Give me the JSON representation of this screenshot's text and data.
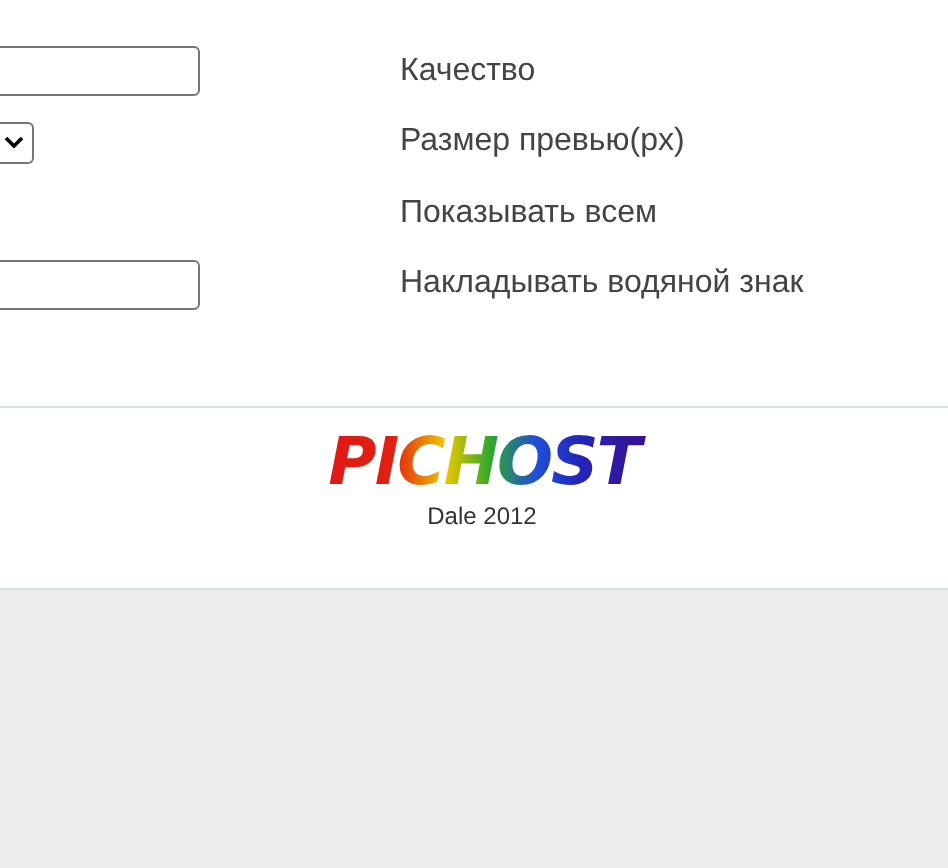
{
  "settings": [
    {
      "kind": "text",
      "label": "Качество"
    },
    {
      "kind": "select",
      "label": "Размер превью(px)"
    },
    {
      "kind": "none",
      "label": "Показывать всем"
    },
    {
      "kind": "text",
      "label": "Накладывать водяной знак"
    }
  ],
  "footer": {
    "logo": "PICHOST",
    "credit": "Dale 2012"
  }
}
